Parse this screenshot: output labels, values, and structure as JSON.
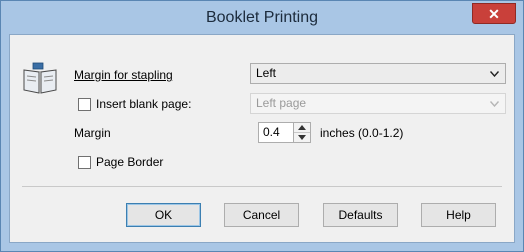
{
  "window": {
    "title": "Booklet Printing",
    "close_symbol": "✕"
  },
  "form": {
    "margin_for_stapling": {
      "label": "Margin for stapling",
      "value": "Left"
    },
    "insert_blank_page": {
      "label": "Insert blank page:",
      "checked": false,
      "value": "Left page",
      "disabled": true
    },
    "margin": {
      "label": "Margin",
      "value": "0.4",
      "unit_text": "inches (0.0-1.2)"
    },
    "page_border": {
      "label": "Page Border",
      "checked": false
    }
  },
  "buttons": {
    "ok": "OK",
    "cancel": "Cancel",
    "defaults": "Defaults",
    "help": "Help"
  },
  "icons": {
    "dialog_icon": "booklet-icon",
    "dropdown": "chevron-down-icon"
  }
}
